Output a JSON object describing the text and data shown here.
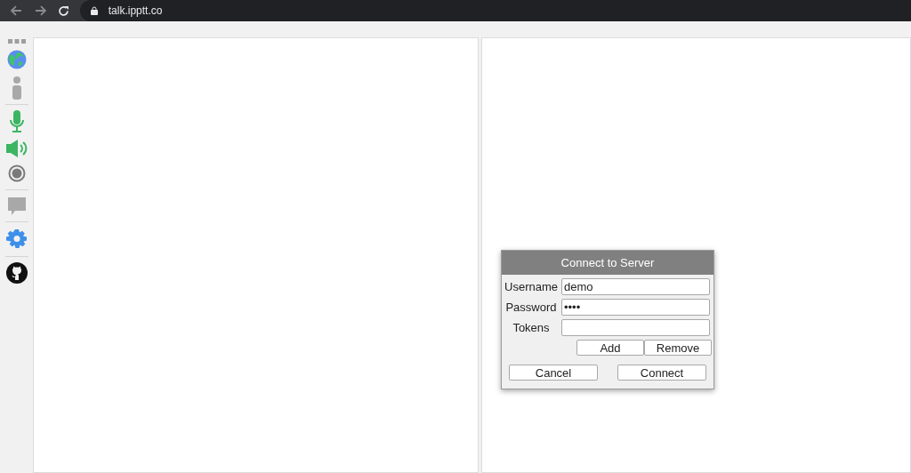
{
  "browser": {
    "url": "talk.ipptt.co"
  },
  "dialog": {
    "title": "Connect to Server",
    "fields": [
      {
        "label": "Username",
        "value": "demo"
      },
      {
        "label": "Password",
        "value": "••••"
      },
      {
        "label": "Tokens"
      }
    ],
    "token_buttons": [
      "Add",
      "Remove"
    ],
    "buttons": [
      "Cancel",
      "Connect"
    ]
  }
}
